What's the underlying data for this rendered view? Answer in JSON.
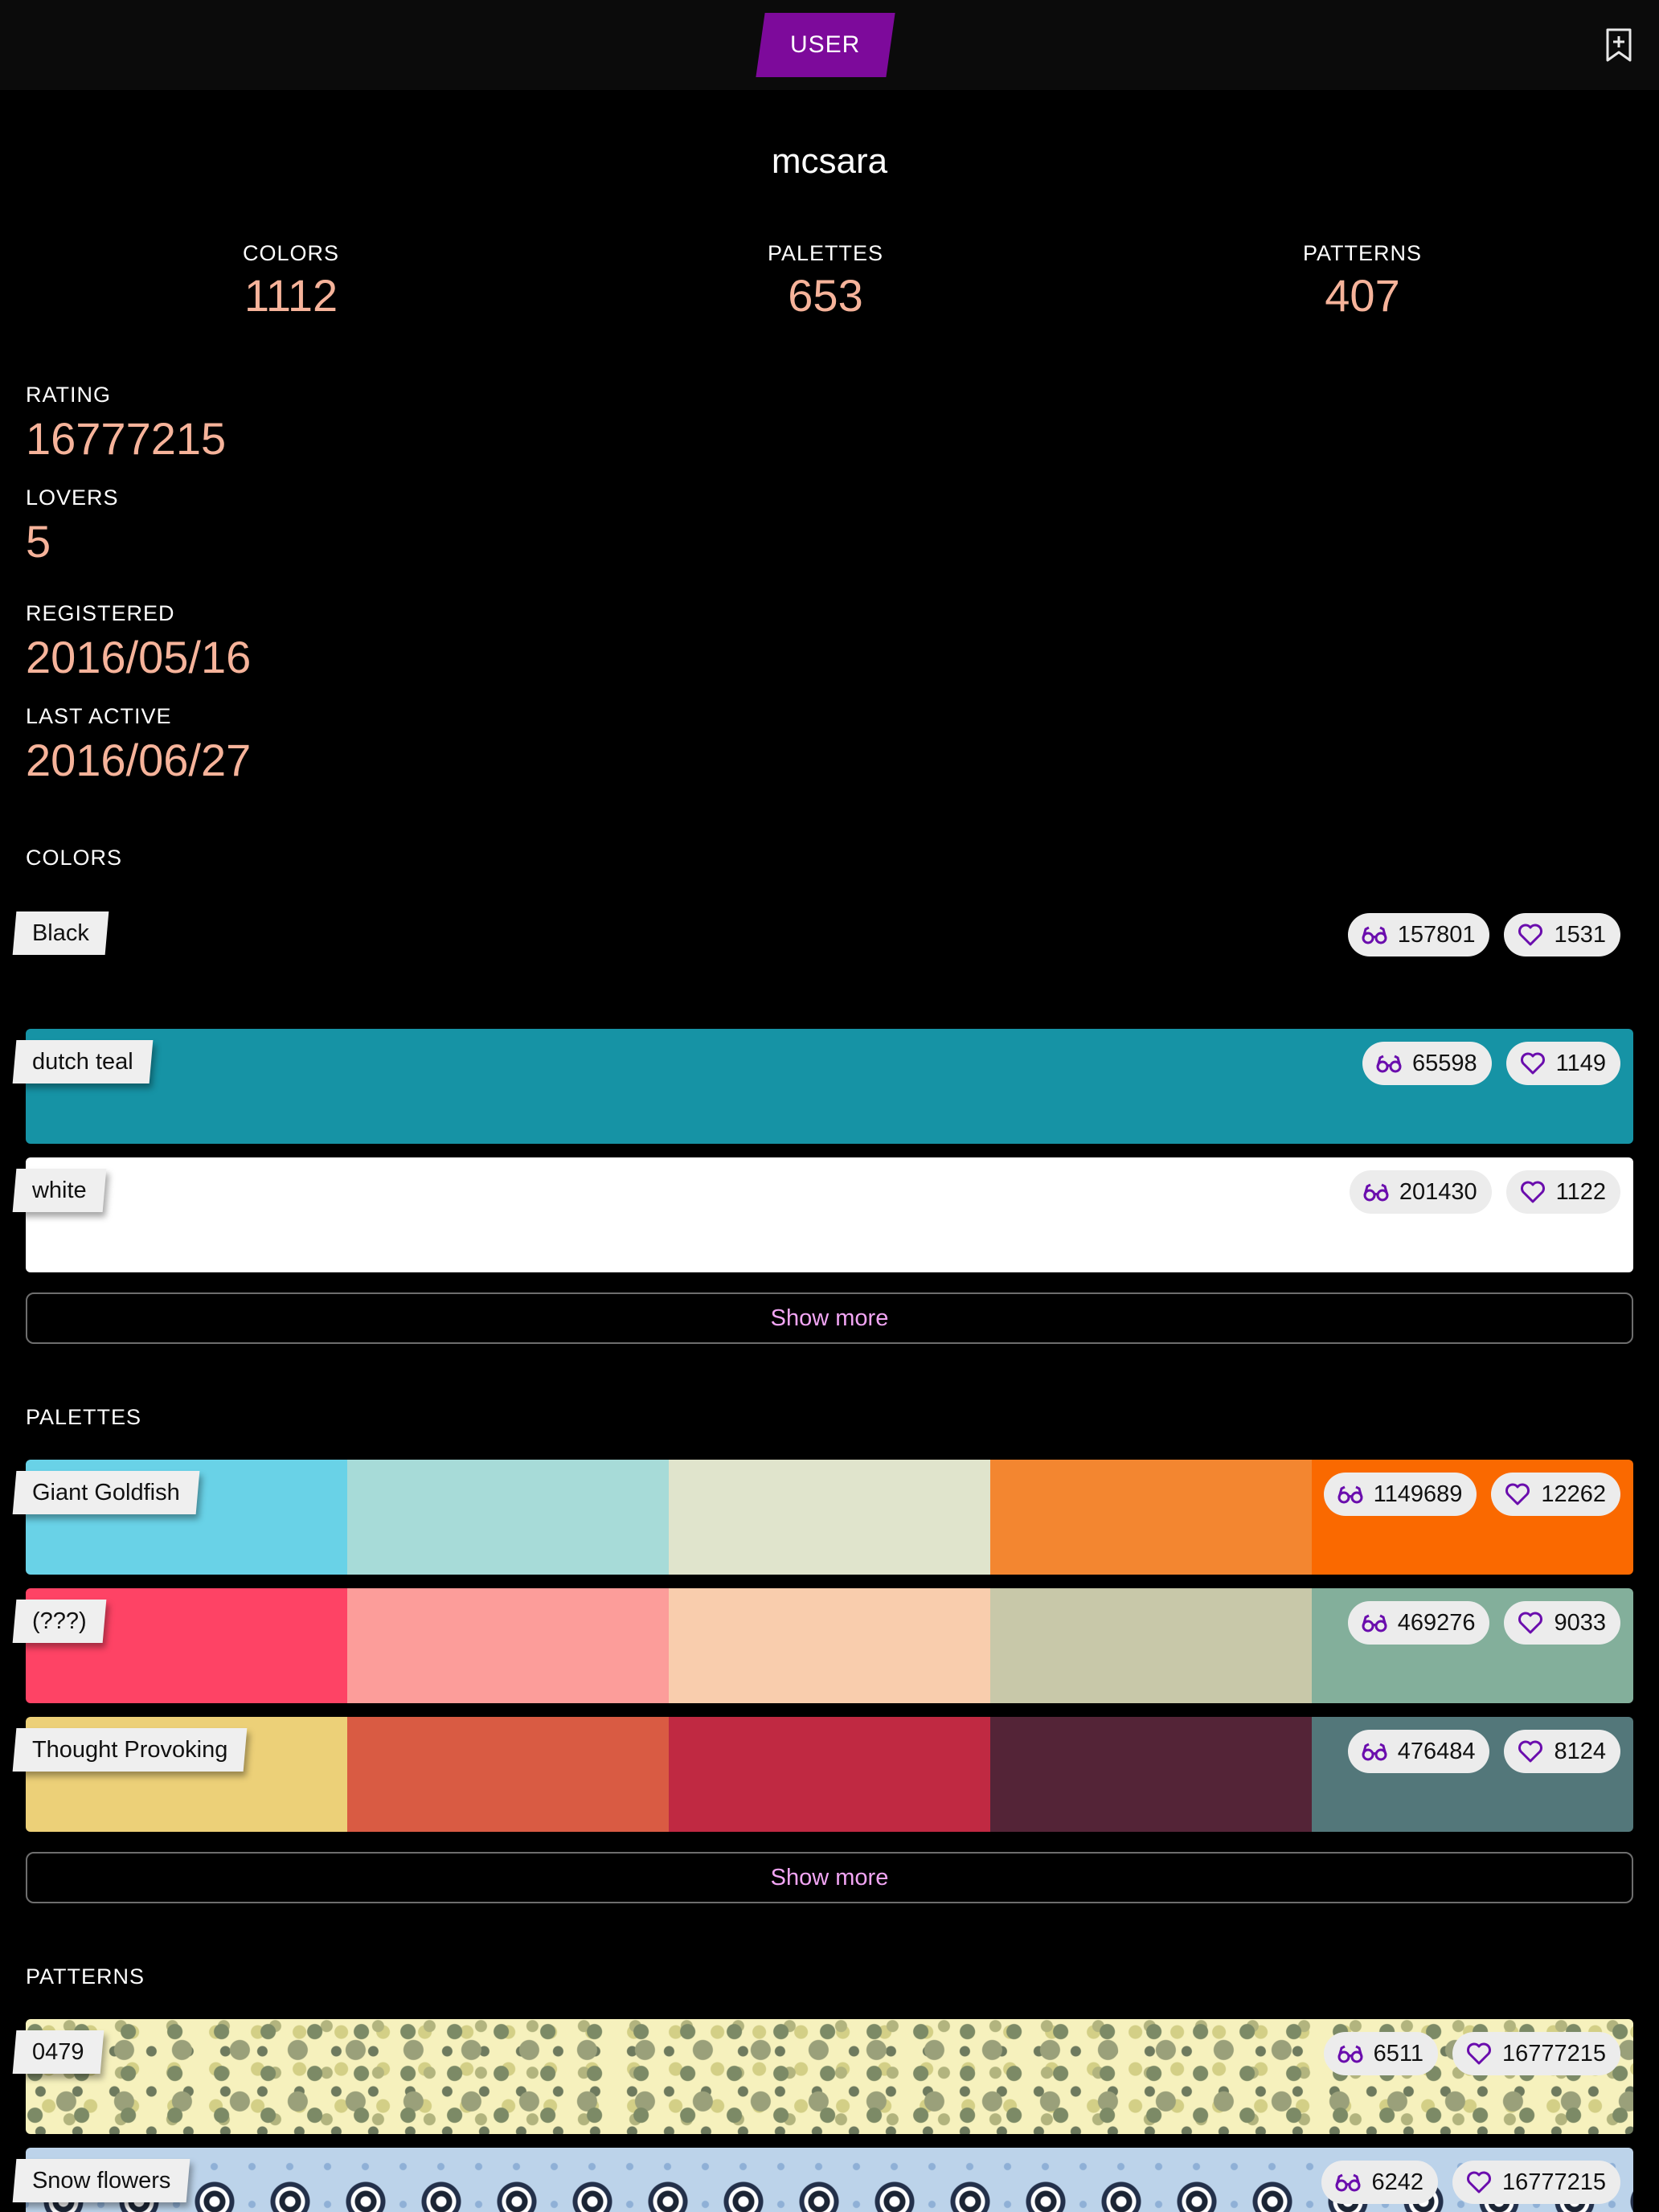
{
  "header": {
    "tab_label": "USER"
  },
  "profile": {
    "username": "mcsara",
    "stats": [
      {
        "label": "COLORS",
        "value": "1112"
      },
      {
        "label": "PALETTES",
        "value": "653"
      },
      {
        "label": "PATTERNS",
        "value": "407"
      }
    ],
    "rating": {
      "label": "RATING",
      "value": "16777215"
    },
    "lovers": {
      "label": "LOVERS",
      "value": "5"
    },
    "registered": {
      "label": "REGISTERED",
      "value": "2016/05/16"
    },
    "last_active": {
      "label": "LAST ACTIVE",
      "value": "2016/06/27"
    }
  },
  "colors": {
    "title": "COLORS",
    "items": [
      {
        "name": "Black",
        "views": "157801",
        "loves": "1531",
        "hex": "#000000"
      },
      {
        "name": "dutch teal",
        "views": "65598",
        "loves": "1149",
        "hex": "#1693A5"
      },
      {
        "name": "white",
        "views": "201430",
        "loves": "1122",
        "hex": "#FFFFFF"
      }
    ],
    "show_more": "Show more"
  },
  "palettes": {
    "title": "PALETTES",
    "items": [
      {
        "name": "Giant Goldfish",
        "views": "1149689",
        "loves": "12262",
        "colors": [
          "#69D2E7",
          "#A7DBD8",
          "#E0E4CC",
          "#F38630",
          "#FA6900"
        ]
      },
      {
        "name": "(???)",
        "views": "469276",
        "loves": "9033",
        "colors": [
          "#FE4365",
          "#FC9D9A",
          "#F9CDAD",
          "#C8C8A9",
          "#83AF9B"
        ]
      },
      {
        "name": "Thought Provoking",
        "views": "476484",
        "loves": "8124",
        "colors": [
          "#ECD078",
          "#D95B43",
          "#C02942",
          "#542437",
          "#53777A"
        ]
      }
    ],
    "show_more": "Show more"
  },
  "patterns": {
    "title": "PATTERNS",
    "items": [
      {
        "name": "0479",
        "views": "6511",
        "loves": "16777215"
      },
      {
        "name": "Snow flowers",
        "views": "6242",
        "loves": "16777215"
      }
    ]
  },
  "icons": {
    "views": "glasses-icon",
    "loves": "heart-icon",
    "bookmark": "bookmark-add-icon"
  },
  "accent_colors": {
    "tab": "#7D0A9B",
    "values": "#F6B39A",
    "show_more": "#F2A5F4",
    "icon": "#6A0DAD"
  }
}
